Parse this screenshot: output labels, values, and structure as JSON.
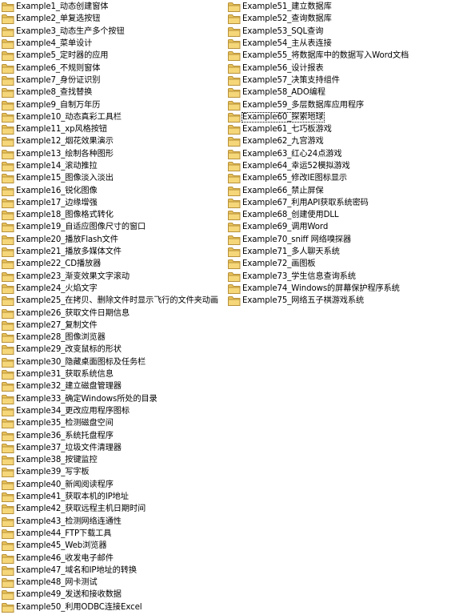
{
  "window": {
    "view": "file list",
    "selected_item": "Example60_探索地球"
  },
  "icon": "folder-icon",
  "colors": {
    "folder_body": "#f5d77a",
    "folder_tab": "#e8c25a",
    "folder_edge": "#b8913a",
    "background": "#ffffff"
  },
  "columns": [
    {
      "items": [
        {
          "label": "Example1_动态创建窗体"
        },
        {
          "label": "Example2_单复选按钮"
        },
        {
          "label": "Example3_动态生产多个按钮"
        },
        {
          "label": "Example4_菜单设计"
        },
        {
          "label": "Example5_定时器的应用"
        },
        {
          "label": "Example6_不规则窗体"
        },
        {
          "label": "Example7_身份证识别"
        },
        {
          "label": "Example8_查找替换"
        },
        {
          "label": "Example9_自制万年历"
        },
        {
          "label": "Example10_动态真彩工具栏"
        },
        {
          "label": "Example11_xp风格按钮"
        },
        {
          "label": "Example12_烟花效果演示"
        },
        {
          "label": "Example13_绘制各种图形"
        },
        {
          "label": "Example14_滚动推拉"
        },
        {
          "label": "Example15_图像淡入淡出"
        },
        {
          "label": "Example16_锐化图像"
        },
        {
          "label": "Example17_边缘增强"
        },
        {
          "label": "Example18_图像格式转化"
        },
        {
          "label": "Example19_自适应图像尺寸的窗口"
        },
        {
          "label": "Example20_播放Flash文件"
        },
        {
          "label": "Example21_播放多媒体文件"
        },
        {
          "label": "Example22_CD播放器"
        },
        {
          "label": "Example23_渐变效果文字滚动"
        },
        {
          "label": "Example24_火焰文字"
        },
        {
          "label": "Example25_在拷贝、删除文件时显示飞行的文件夹动画"
        },
        {
          "label": "Example26_获取文件日期信息"
        },
        {
          "label": "Example27_复制文件"
        },
        {
          "label": "Example28_图像浏览器"
        },
        {
          "label": "Example29_改变鼠标的形状"
        },
        {
          "label": "Example30_隐藏桌面图标及任务栏"
        },
        {
          "label": "Example31_获取系统信息"
        },
        {
          "label": "Example32_建立磁盘管理器"
        },
        {
          "label": "Example33_确定Windows所处的目录"
        },
        {
          "label": "Example34_更改应用程序图标"
        },
        {
          "label": "Example35_检测磁盘空间"
        },
        {
          "label": "Example36_系统托盘程序"
        },
        {
          "label": "Example37_垃圾文件清理器"
        },
        {
          "label": "Example38_按键监控"
        },
        {
          "label": "Example39_写字板"
        },
        {
          "label": "Example40_新闻阅读程序"
        },
        {
          "label": "Example41_获取本机的IP地址"
        },
        {
          "label": "Example42_获取远程主机日期时间"
        },
        {
          "label": "Example43_检测网络连通性"
        },
        {
          "label": "Example44_FTP下载工具"
        },
        {
          "label": "Example45_Web浏览器"
        },
        {
          "label": "Example46_收发电子邮件"
        },
        {
          "label": "Example47_域名和IP地址的转换"
        },
        {
          "label": "Example48_网卡测试"
        },
        {
          "label": "Example49_发送和接收数据"
        },
        {
          "label": "Example50_利用ODBC连接Excel"
        }
      ]
    },
    {
      "items": [
        {
          "label": "Example51_建立数据库"
        },
        {
          "label": "Example52_查询数据库"
        },
        {
          "label": "Example53_SQL查询"
        },
        {
          "label": "Example54_主从表连接"
        },
        {
          "label": "Example55_将数据库中的数据写入Word文档"
        },
        {
          "label": "Example56_设计报表"
        },
        {
          "label": "Example57_决策支持组件"
        },
        {
          "label": "Example58_ADO编程"
        },
        {
          "label": "Example59_多层数据库应用程序"
        },
        {
          "label": "Example60_探索地球"
        },
        {
          "label": "Example61_七巧板游戏"
        },
        {
          "label": "Example62_九宫游戏"
        },
        {
          "label": "Example63_红心24点游戏"
        },
        {
          "label": "Example64_幸运52模拟游戏"
        },
        {
          "label": "Example65_修改IE图标显示"
        },
        {
          "label": "Example66_禁止屏保"
        },
        {
          "label": "Example67_利用API获取系统密码"
        },
        {
          "label": "Example68_创建使用DLL"
        },
        {
          "label": "Example69_调用Word"
        },
        {
          "label": "Example70_sniff 网络嗅探器"
        },
        {
          "label": "Example71_多人聊天系统"
        },
        {
          "label": "Example72_画图板"
        },
        {
          "label": "Example73_学生信息查询系统"
        },
        {
          "label": "Example74_Windows的屏幕保护程序系统"
        },
        {
          "label": "Example75_网络五子棋游戏系统"
        }
      ]
    }
  ]
}
